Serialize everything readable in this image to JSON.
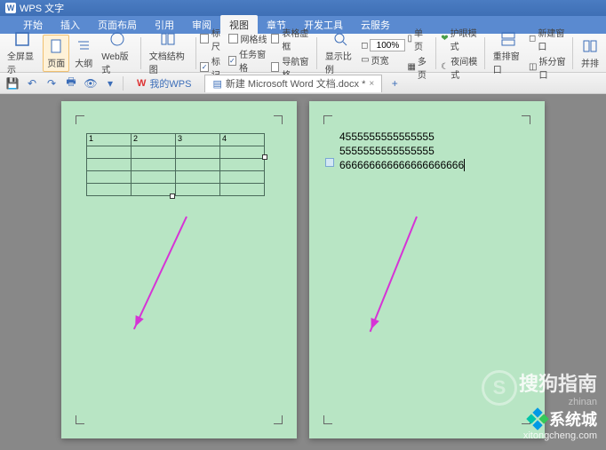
{
  "app": {
    "name": "WPS 文字"
  },
  "menu": {
    "items": [
      "开始",
      "插入",
      "页面布局",
      "引用",
      "审阅",
      "视图",
      "章节",
      "开发工具",
      "云服务"
    ],
    "active": "视图"
  },
  "ribbon": {
    "view_btns": [
      {
        "label": "全屏显示",
        "name": "fullscreen-button"
      },
      {
        "label": "页面",
        "name": "page-view-button",
        "active": true
      },
      {
        "label": "大纲",
        "name": "outline-button"
      },
      {
        "label": "Web版式",
        "name": "web-layout-button"
      }
    ],
    "structure_label": "文档结构图",
    "checks_col1": [
      {
        "label": "标尺",
        "checked": false
      },
      {
        "label": "标记",
        "checked": true
      }
    ],
    "checks_col2": [
      {
        "label": "网格线",
        "checked": false
      },
      {
        "label": "任务窗格",
        "checked": true
      }
    ],
    "checks_col3": [
      {
        "label": "表格虚框",
        "checked": false
      },
      {
        "label": "导航窗格",
        "checked": false
      }
    ],
    "zoom_label": "显示比例",
    "zoom_value": "100%",
    "single_page": "单页",
    "multi_page": "多页",
    "page_width": "页宽",
    "eye_label": "护眼模式",
    "night_label": "夜间模式",
    "rearrange_label": "重排窗口",
    "new_window": "新建窗口",
    "split_window": "拆分窗口",
    "side_label": "并排"
  },
  "tabs": {
    "home": "我的WPS",
    "doc": "新建 Microsoft Word 文档.docx *"
  },
  "document": {
    "table_headers": [
      "1",
      "2",
      "3",
      "4"
    ],
    "page2_lines": [
      "4555555555555555",
      "5555555555555555",
      "666666666666666666666"
    ]
  },
  "watermark": {
    "sogou": "搜狗指南",
    "zhinan": "zhinan",
    "xtc": "系统城",
    "url": "xitongcheng.com"
  }
}
